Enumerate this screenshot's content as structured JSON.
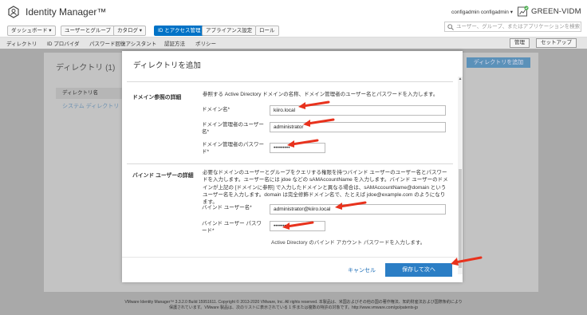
{
  "header": {
    "app_title": "Identity Manager™",
    "user": "configadmin configadmin ▾",
    "tenant": "GREEN-VIDM"
  },
  "tabs": [
    {
      "label": "ダッシュボード ▾"
    },
    {
      "label": "ユーザーとグループ"
    },
    {
      "label": "カタログ ▾"
    },
    {
      "label": "ID とアクセス管理"
    },
    {
      "label": "アプライアンス設定"
    },
    {
      "label": "ロール"
    }
  ],
  "search": {
    "placeholder": "ユーザー、グループ、またはアプリケーションを検索"
  },
  "subnav": {
    "items": [
      {
        "label": "ディレクトリ"
      },
      {
        "label": "ID プロバイダ"
      },
      {
        "label": "パスワード回復アシスタント"
      },
      {
        "label": "認証方法"
      },
      {
        "label": "ポリシー"
      }
    ],
    "manage": "管理",
    "setup": "セットアップ"
  },
  "background": {
    "title": "ディレクトリ (1)",
    "add_button": "ディレクトリを追加",
    "table_header": "ディレクトリ名",
    "row": "システム ディレクトリ"
  },
  "modal": {
    "title": "ディレクトリを追加",
    "domain_section": {
      "label": "ドメイン参照の詳細",
      "desc": "参照する Active Directory ドメインの名称、ドメイン管理者のユーザー名とパスワードを入力します。",
      "domain_name_label": "ドメイン名*",
      "domain_name_value": "kiiro.local",
      "admin_user_label": "ドメイン管理者のユーザー名*",
      "admin_user_value": "administrator",
      "admin_pass_label": "ドメイン管理者のパスワード*",
      "admin_pass_value": "•••••••••"
    },
    "bind_section": {
      "label": "バインド ユーザーの詳細",
      "desc": "必要なドメインのユーザーとグループをクエリする権限を持つバインド ユーザーのユーザー名とパスワードを入力します。ユーザー名には jdoe などの sAMAccountName を入力します。バインド ユーザーのドメインが上記の [ドメインに参照] で入力したドメインと異なる場合は、sAMAccountName@domain というユーザー名を入力します。domain は完全修飾ドメイン名で、たとえば jdoe@example.com のようになります。",
      "bind_user_label": "バインド ユーザー名*",
      "bind_user_value": "administrator@kiiro.local",
      "bind_pass_label": "バインド ユーザー パスワード*",
      "bind_pass_value": "•••••••••",
      "bind_pass_help": "Active Directory のバインド アカウント パスワードを入力します。"
    },
    "cancel": "キャンセル",
    "save": "保存して次へ"
  },
  "footer": {
    "line1": "VMware Identity Manager™ 3.3.2.0 Build 15951611. Copyright © 2013-2020 VMware, Inc. All rights reserved. 本製品は、米国およびその他の国の著作権法、知的財産法および国際条約により",
    "line2": "保護されています。VMware 製品は、次のリストに表示されている 1 件または複数の特許の対象です。http://www.vmware.com/go/patents-jp"
  },
  "colors": {
    "accent": "#0072c6",
    "annotation_arrow": "#e8321d",
    "subnav_bg": "#e5e5e5"
  }
}
